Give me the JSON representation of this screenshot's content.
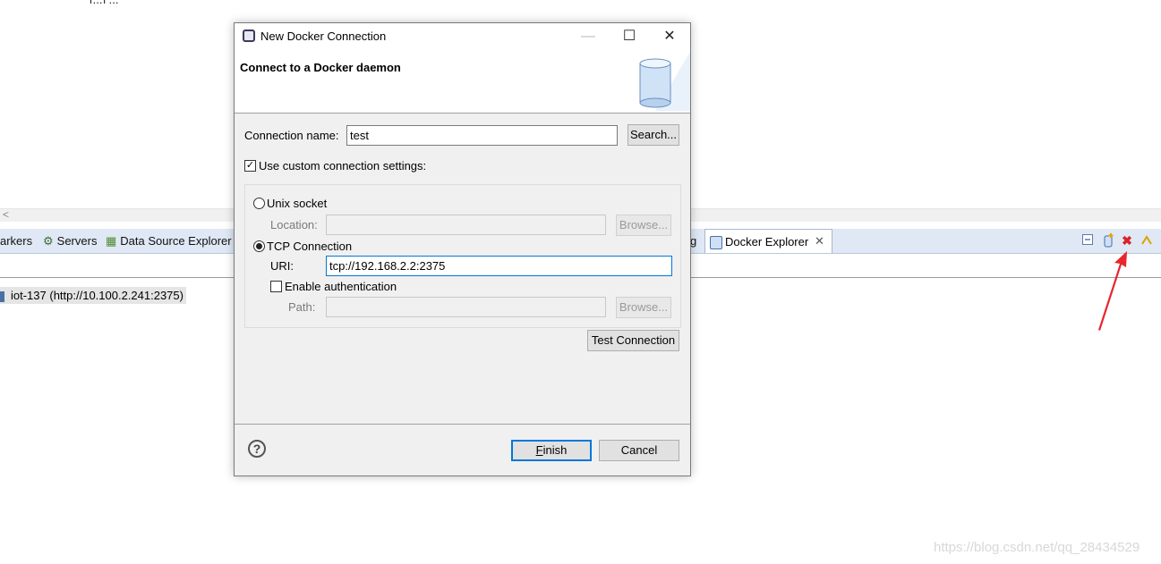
{
  "background": {
    "top_text": "[...] ...",
    "tabs": [
      {
        "label": "arkers",
        "icon": "markers-icon"
      },
      {
        "label": "Servers",
        "icon": "servers-icon"
      },
      {
        "label": "Data Source Explorer",
        "icon": "data-source-icon"
      },
      {
        "label": "g",
        "icon": ""
      }
    ],
    "active_tab": {
      "label": "Docker Explorer",
      "close": "✕"
    },
    "tree_item": "iot-137 (http://10.100.2.241:2375)",
    "watermark": "https://blog.csdn.net/qq_28434529",
    "scroll_arrow": "<",
    "accent_arrow_color": "#e8262b"
  },
  "dialog": {
    "window_title": "New Docker Connection",
    "header_title": "Connect to a Docker daemon",
    "connection_name_label": "Connection name:",
    "connection_name_value": "test",
    "search_button": "Search...",
    "use_custom_label": "Use custom connection settings:",
    "use_custom_checked": true,
    "unix_socket_label": "Unix socket",
    "location_label": "Location:",
    "location_value": "",
    "browse_label": "Browse...",
    "tcp_label": "TCP Connection",
    "uri_label": "URI:",
    "uri_value": "tcp://192.168.2.2:2375",
    "enable_auth_label": "Enable authentication",
    "path_label": "Path:",
    "path_value": "",
    "test_connection": "Test Connection",
    "finish_prefix": "F",
    "finish_rest": "inish",
    "cancel": "Cancel",
    "help": "?"
  }
}
